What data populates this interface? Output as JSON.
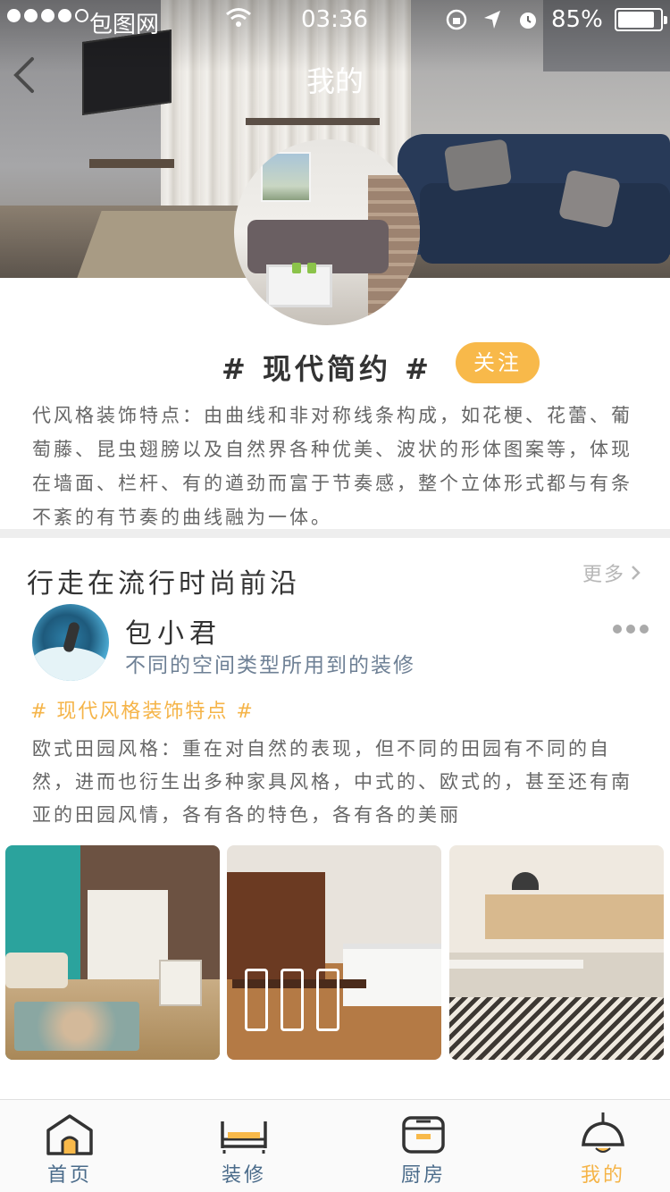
{
  "status_bar": {
    "carrier": "包图网",
    "time": "03:36",
    "battery_percent": "85%",
    "battery_level": 0.85,
    "signal_bars": 4
  },
  "header": {
    "title": "我的",
    "back_icon": "chevron-left-icon"
  },
  "profile": {
    "style_title": "# 现代简约 #",
    "follow_label": "关注",
    "description": "代风格装饰特点：由曲线和非对称线条构成，如花梗、花蕾、葡萄藤、昆虫翅膀以及自然界各种优美、波状的形体图案等，体现在墙面、栏杆、有的遒劲而富于节奏感，整个立体形式都与有条不紊的有节奏的曲线融为一体。"
  },
  "section": {
    "title": "行走在流行时尚前沿",
    "more_label": "更多"
  },
  "post": {
    "user_name": "包小君",
    "user_subtitle": "不同的空间类型所用到的装修",
    "tag": "# 现代风格装饰特点 #",
    "body": "欧式田园风格：重在对自然的表现，但不同的田园有不同的自然，进而也衍生出多种家具风格，中式的、欧式的，甚至还有南亚的田园风情，各有各的特色，各有各的美丽"
  },
  "tabbar": {
    "items": [
      {
        "label": "首页",
        "icon": "home-icon"
      },
      {
        "label": "装修",
        "icon": "bed-icon"
      },
      {
        "label": "厨房",
        "icon": "rice-cooker-icon"
      },
      {
        "label": "我的",
        "icon": "pendant-lamp-icon",
        "active": true
      }
    ]
  },
  "colors": {
    "accent": "#f8b94a",
    "tab_inactive": "#4a6b8a",
    "subtitle": "#6e8095"
  }
}
